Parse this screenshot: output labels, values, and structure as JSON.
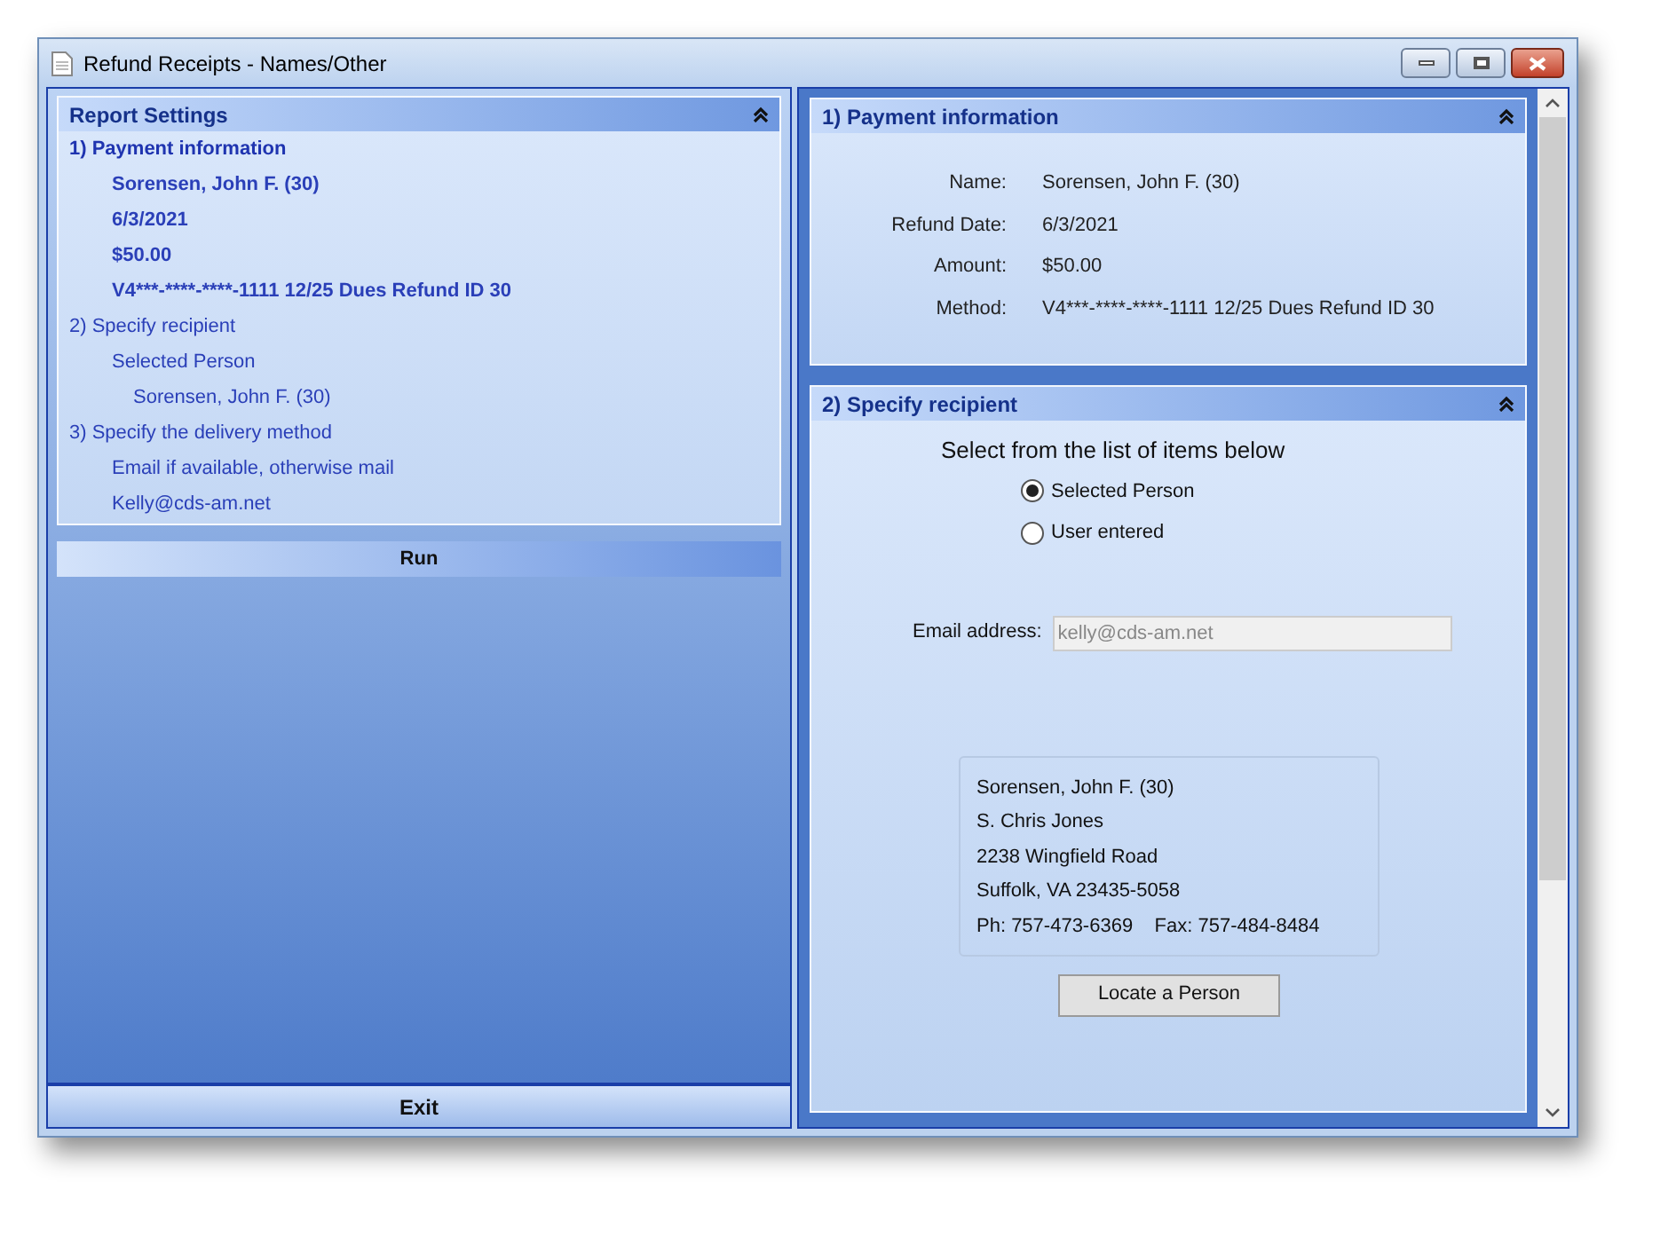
{
  "window": {
    "title": "Refund Receipts - Names/Other"
  },
  "report_settings": {
    "title": "Report Settings",
    "expanded": true,
    "sections": [
      {
        "title": "1)  Payment information",
        "active": true,
        "children": [
          {
            "text": "Sorensen, John F. (30)"
          },
          {
            "text": "6/3/2021"
          },
          {
            "text": "$50.00"
          },
          {
            "text": "V4***-****-****-1111 12/25 Dues Refund ID 30"
          }
        ]
      },
      {
        "title": "2)  Specify recipient",
        "active": false,
        "children": [
          {
            "text": "Selected Person",
            "children": [
              {
                "text": "Sorensen, John F. (30)"
              }
            ]
          }
        ]
      },
      {
        "title": "3)  Specify the delivery method",
        "active": false,
        "children": [
          {
            "text": "Email if available, otherwise mail"
          },
          {
            "text": "Kelly@cds-am.net"
          }
        ]
      }
    ]
  },
  "run_button": "Run",
  "exit_button": "Exit",
  "payment_information": {
    "title": "1)  Payment information",
    "expanded": true,
    "fields": [
      {
        "label": "Name:",
        "value": "Sorensen, John F. (30)"
      },
      {
        "label": "Refund Date:",
        "value": "6/3/2021"
      },
      {
        "label": "Amount:",
        "value": "$50.00"
      },
      {
        "label": "Method:",
        "value": "V4***-****-****-1111 12/25 Dues Refund ID 30"
      }
    ]
  },
  "specify_recipient": {
    "title": "2)  Specify recipient",
    "expanded": true,
    "prompt": "Select from the list of items below",
    "options": [
      {
        "label": "Selected Person",
        "selected": true
      },
      {
        "label": "User entered",
        "selected": false
      }
    ],
    "email": {
      "label": "Email address:",
      "value": "kelly@cds-am.net",
      "disabled": true
    },
    "address_lines": [
      "Sorensen, John F. (30)",
      "S. Chris Jones",
      "2238 Wingfield Road",
      "Suffolk, VA 23435-5058",
      "Ph: 757-473-6369    Fax: 757-484-8484"
    ],
    "locate_button": "Locate a Person"
  }
}
